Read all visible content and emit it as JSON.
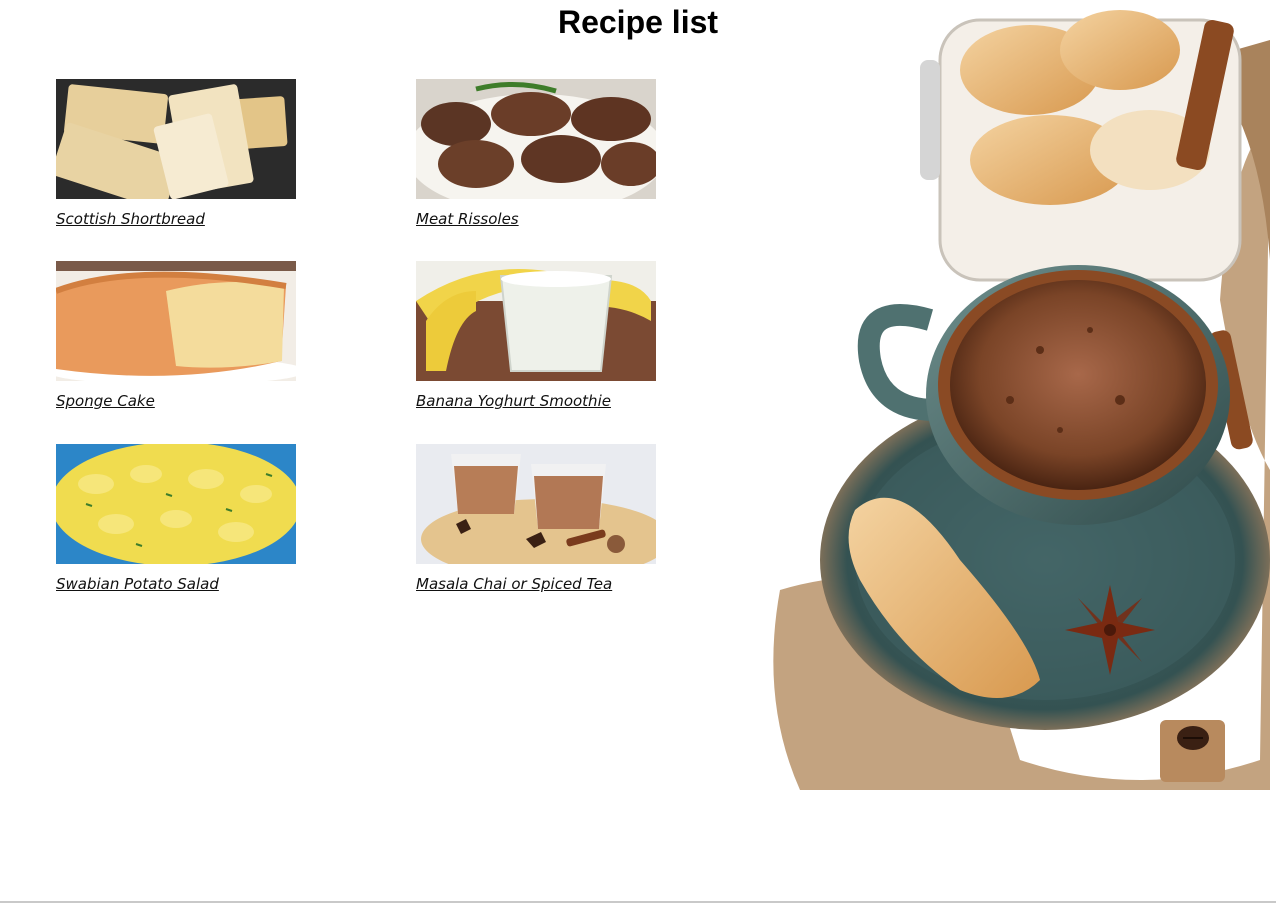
{
  "page": {
    "title": "Recipe list"
  },
  "recipes": [
    {
      "label": "Scottish Shortbread",
      "image": "shortbread-photo"
    },
    {
      "label": "Meat Rissoles",
      "image": "rissoles-photo"
    },
    {
      "label": "Sponge Cake",
      "image": "sponge-cake-photo"
    },
    {
      "label": "Banana Yoghurt Smoothie",
      "image": "smoothie-photo"
    },
    {
      "label": "Swabian Potato Salad",
      "image": "potato-salad-photo"
    },
    {
      "label": "Masala Chai or Spiced Tea",
      "image": "chai-photo"
    }
  ],
  "hero": {
    "image": "coffee-croissant-photo"
  },
  "colors": {
    "link": "#111111",
    "background": "#ffffff",
    "title": "#000000"
  }
}
